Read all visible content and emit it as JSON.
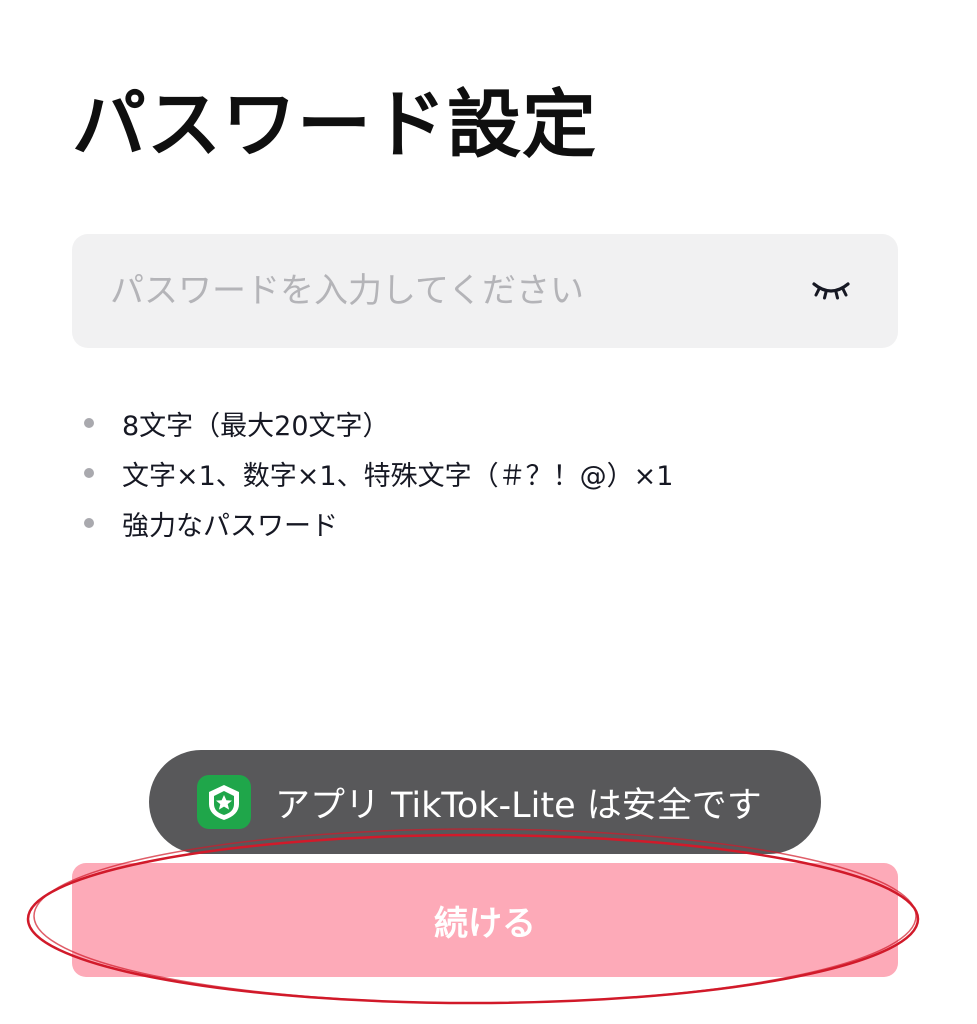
{
  "page": {
    "title": "パスワード設定"
  },
  "password_field": {
    "placeholder": "パスワードを入力してください",
    "value": "",
    "toggle_icon": "eye-closed-icon"
  },
  "rules": [
    {
      "text": "8文字（最大20文字）"
    },
    {
      "text": "文字×1、数字×1、特殊文字（＃？！@）×1"
    },
    {
      "text": "強力なパスワード"
    }
  ],
  "toast": {
    "icon": "security-shield-icon",
    "text": "アプリ TikTok-Lite は安全です"
  },
  "continue_button": {
    "label": "続ける"
  },
  "colors": {
    "button_disabled": "#fdaab8",
    "toast_bg": "#58585a",
    "field_bg": "#f1f1f2",
    "annotation": "#d11a2a",
    "shield_green": "#1fa64a"
  }
}
